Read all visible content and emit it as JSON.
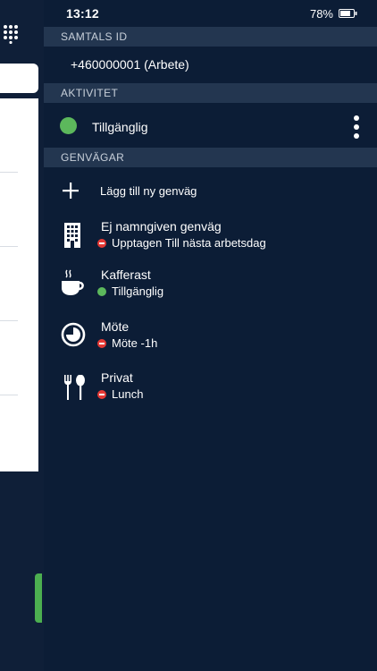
{
  "status_bar": {
    "time": "13:12",
    "battery_percent": "78%",
    "battery_level": 0.78
  },
  "sections": {
    "call_id": "SAMTALS ID",
    "activity": "AKTIVITET",
    "shortcuts": "GENVÄGAR"
  },
  "call_id": {
    "number": "+460000001 (Arbete)"
  },
  "activity": {
    "label": "Tillgänglig",
    "status": "available",
    "color": "#5cb85c"
  },
  "shortcuts": {
    "add_label": "Lägg till ny genväg",
    "items": [
      {
        "title": "Ej namngiven genväg",
        "status": "Upptagen Till nästa arbetsdag",
        "state": "busy",
        "icon": "building-icon"
      },
      {
        "title": "Kafferast",
        "status": "Tillgänglig",
        "state": "available",
        "icon": "coffee-cup-icon"
      },
      {
        "title": "Möte",
        "status": "Möte -1h",
        "state": "busy",
        "icon": "clock-icon"
      },
      {
        "title": "Privat",
        "status": "Lunch",
        "state": "busy",
        "icon": "fork-spoon-icon"
      }
    ]
  },
  "colors": {
    "background": "#0c1d36",
    "section_header": "#233650",
    "available": "#5cb85c",
    "busy": "#e53935",
    "accent_green": "#4caf50"
  }
}
